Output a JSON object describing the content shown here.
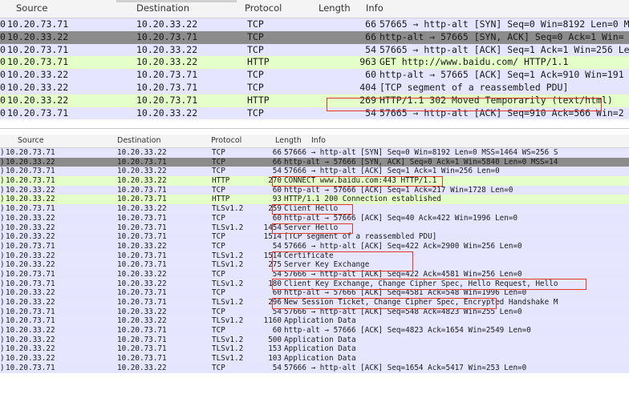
{
  "colors": {
    "tcp": "#e6e5ff",
    "http": "#e4ffc7",
    "tls": "#e7e6ff",
    "selected": "#8c8c8c",
    "highlight": "#e0392b"
  },
  "top_pane": {
    "headers": {
      "source": "Source",
      "destination": "Destination",
      "protocol": "Protocol",
      "length": "Length",
      "info": "Info"
    },
    "rows": [
      {
        "no": "0",
        "source": "10.20.73.71",
        "destination": "10.20.33.22",
        "protocol": "TCP",
        "length": "66",
        "info": "57665 → http-alt [SYN] Seq=0 Win=8192 Len=0 M",
        "style": "tcp"
      },
      {
        "no": "0",
        "source": "10.20.33.22",
        "destination": "10.20.73.71",
        "protocol": "TCP",
        "length": "66",
        "info": "http-alt → 57665 [SYN, ACK] Seq=0 Ack=1 Win=",
        "style": "selected"
      },
      {
        "no": "0",
        "source": "10.20.73.71",
        "destination": "10.20.33.22",
        "protocol": "TCP",
        "length": "54",
        "info": "57665 → http-alt [ACK] Seq=1 Ack=1 Win=256 Le",
        "style": "tcp"
      },
      {
        "no": "0",
        "source": "10.20.73.71",
        "destination": "10.20.33.22",
        "protocol": "HTTP",
        "length": "963",
        "info": "GET http://www.baidu.com/ HTTP/1.1",
        "style": "http"
      },
      {
        "no": "0",
        "source": "10.20.33.22",
        "destination": "10.20.73.71",
        "protocol": "TCP",
        "length": "60",
        "info": "http-alt → 57665 [ACK] Seq=1 Ack=910 Win=191",
        "style": "tcp"
      },
      {
        "no": "0",
        "source": "10.20.33.22",
        "destination": "10.20.73.71",
        "protocol": "TCP",
        "length": "404",
        "info": "[TCP segment of a reassembled PDU]",
        "style": "tcp"
      },
      {
        "no": "0",
        "source": "10.20.33.22",
        "destination": "10.20.73.71",
        "protocol": "HTTP",
        "length": "269",
        "info": "HTTP/1.1 302 Moved Temporarily  (text/html)",
        "style": "http"
      },
      {
        "no": "0",
        "source": "10.20.73.71",
        "destination": "10.20.33.22",
        "protocol": "TCP",
        "length": "54",
        "info": "57665 → http-alt [ACK] Seq=910 Ack=566 Win=2",
        "style": "tcp"
      }
    ]
  },
  "bottom_pane": {
    "headers": {
      "source": "Source",
      "destination": "Destination",
      "protocol": "Protocol",
      "length": "Length",
      "info": "Info"
    },
    "rows": [
      {
        "no": ")",
        "source": "10.20.73.71",
        "destination": "10.20.33.22",
        "protocol": "TCP",
        "length": "66",
        "info": "57666 → http-alt [SYN] Seq=0 Win=8192 Len=0 MSS=1464 WS=256 S",
        "style": "tcp"
      },
      {
        "no": ")",
        "source": "10.20.33.22",
        "destination": "10.20.73.71",
        "protocol": "TCP",
        "length": "66",
        "info": "http-alt → 57666 [SYN, ACK] Seq=0 Ack=1 Win=5840 Len=0 MSS=14",
        "style": "selected"
      },
      {
        "no": ")",
        "source": "10.20.73.71",
        "destination": "10.20.33.22",
        "protocol": "TCP",
        "length": "54",
        "info": "57666 → http-alt [ACK] Seq=1 Ack=1 Win=256 Len=0",
        "style": "tcp"
      },
      {
        "no": ")",
        "source": "10.20.73.71",
        "destination": "10.20.33.22",
        "protocol": "HTTP",
        "length": "270",
        "info": "CONNECT www.baidu.com:443 HTTP/1.1",
        "style": "http"
      },
      {
        "no": ")",
        "source": "10.20.33.22",
        "destination": "10.20.73.71",
        "protocol": "TCP",
        "length": "60",
        "info": "http-alt → 57666 [ACK] Seq=1 Ack=217 Win=1728 Len=0",
        "style": "tcp"
      },
      {
        "no": ")",
        "source": "10.20.33.22",
        "destination": "10.20.73.71",
        "protocol": "HTTP",
        "length": "93",
        "info": "HTTP/1.1 200 Connection established",
        "style": "http"
      },
      {
        "no": ")",
        "source": "10.20.73.71",
        "destination": "10.20.33.22",
        "protocol": "TLSv1.2",
        "length": "259",
        "info": "Client Hello",
        "style": "tls"
      },
      {
        "no": ")",
        "source": "10.20.33.22",
        "destination": "10.20.73.71",
        "protocol": "TCP",
        "length": "60",
        "info": "http-alt → 57666 [ACK] Seq=40 Ack=422 Win=1996 Len=0",
        "style": "tcp"
      },
      {
        "no": ")",
        "source": "10.20.33.22",
        "destination": "10.20.73.71",
        "protocol": "TLSv1.2",
        "length": "1454",
        "info": "Server Hello",
        "style": "tls"
      },
      {
        "no": ")",
        "source": "10.20.33.22",
        "destination": "10.20.73.71",
        "protocol": "TCP",
        "length": "1514",
        "info": "[TCP segment of a reassembled PDU]",
        "style": "tcp"
      },
      {
        "no": ")",
        "source": "10.20.73.71",
        "destination": "10.20.33.22",
        "protocol": "TCP",
        "length": "54",
        "info": "57666 → http-alt [ACK] Seq=422 Ack=2900 Win=256 Len=0",
        "style": "tcp"
      },
      {
        "no": ")",
        "source": "10.20.33.22",
        "destination": "10.20.73.71",
        "protocol": "TLSv1.2",
        "length": "1514",
        "info": "Certificate",
        "style": "tls"
      },
      {
        "no": ")",
        "source": "10.20.33.22",
        "destination": "10.20.73.71",
        "protocol": "TLSv1.2",
        "length": "275",
        "info": "Server Key Exchange",
        "style": "tls"
      },
      {
        "no": ")",
        "source": "10.20.73.71",
        "destination": "10.20.33.22",
        "protocol": "TCP",
        "length": "54",
        "info": "57666 → http-alt [ACK] Seq=422 Ack=4581 Win=256 Len=0",
        "style": "tcp"
      },
      {
        "no": ")",
        "source": "10.20.73.71",
        "destination": "10.20.33.22",
        "protocol": "TLSv1.2",
        "length": "180",
        "info": "Client Key Exchange, Change Cipher Spec, Hello Request, Hello",
        "style": "tls"
      },
      {
        "no": ")",
        "source": "10.20.33.22",
        "destination": "10.20.73.71",
        "protocol": "TCP",
        "length": "60",
        "info": "http-alt → 57666 [ACK] Seq=4581 Ack=548 Win=1996 Len=0",
        "style": "tcp"
      },
      {
        "no": ")",
        "source": "10.20.33.22",
        "destination": "10.20.73.71",
        "protocol": "TLSv1.2",
        "length": "296",
        "info": "New Session Ticket, Change Cipher Spec, Encrypted Handshake M",
        "style": "tls"
      },
      {
        "no": ")",
        "source": "10.20.73.71",
        "destination": "10.20.33.22",
        "protocol": "TCP",
        "length": "54",
        "info": "57666 → http-alt [ACK] Seq=548 Ack=4823 Win=255 Len=0",
        "style": "tcp"
      },
      {
        "no": ")",
        "source": "10.20.73.71",
        "destination": "10.20.33.22",
        "protocol": "TLSv1.2",
        "length": "1160",
        "info": "Application Data",
        "style": "tls"
      },
      {
        "no": ")",
        "source": "10.20.33.22",
        "destination": "10.20.73.71",
        "protocol": "TCP",
        "length": "60",
        "info": "http-alt → 57666 [ACK] Seq=4823 Ack=1654 Win=2549 Len=0",
        "style": "tcp"
      },
      {
        "no": ")",
        "source": "10.20.33.22",
        "destination": "10.20.73.71",
        "protocol": "TLSv1.2",
        "length": "500",
        "info": "Application Data",
        "style": "tls"
      },
      {
        "no": ")",
        "source": "10.20.33.22",
        "destination": "10.20.73.71",
        "protocol": "TLSv1.2",
        "length": "153",
        "info": "Application Data",
        "style": "tls"
      },
      {
        "no": ")",
        "source": "10.20.33.22",
        "destination": "10.20.73.71",
        "protocol": "TLSv1.2",
        "length": "103",
        "info": "Application Data",
        "style": "tls"
      },
      {
        "no": ")",
        "source": "10.20.73.71",
        "destination": "10.20.33.22",
        "protocol": "TCP",
        "length": "54",
        "info": "57666 → http-alt [ACK] Seq=1654 Ack=5417 Win=253 Len=0",
        "style": "tcp"
      }
    ]
  }
}
